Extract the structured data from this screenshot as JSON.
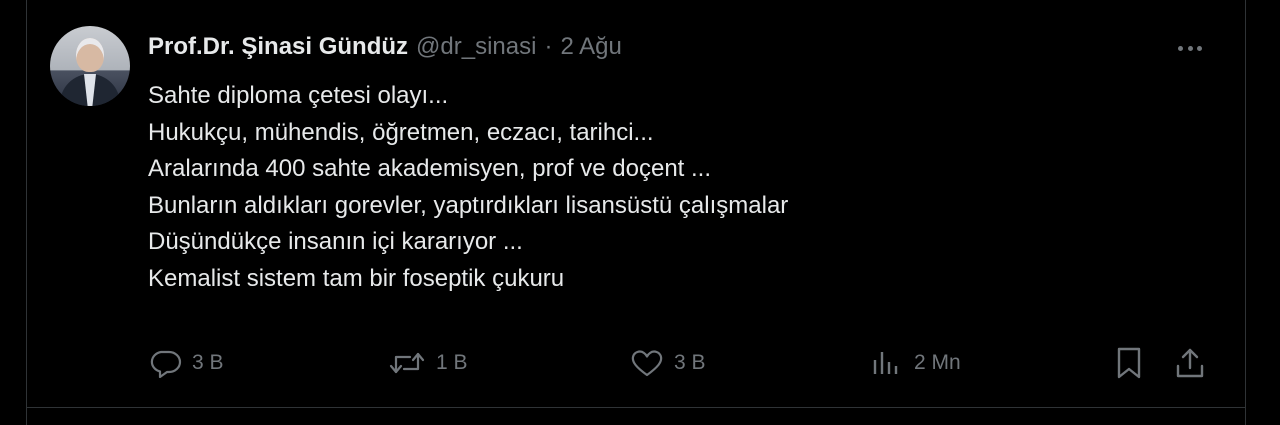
{
  "tweet": {
    "author_name": "Prof.Dr. Şinasi Gündüz",
    "handle": "@dr_sinasi",
    "separator": "·",
    "date": "2 Ağu",
    "lines": [
      "Sahte diploma çetesi olayı...",
      "Hukukçu, mühendis, öğretmen, eczacı, tarihci...",
      "Aralarında 400 sahte akademisyen, prof ve doçent ...",
      "Bunların aldıkları gorevler, yaptırdıkları lisansüstü çalışmalar",
      "Düşündükçe insanın içi kararıyor ...",
      "Kemalist sistem tam bir foseptik çukuru"
    ]
  },
  "actions": {
    "reply_count": "3 B",
    "retweet_count": "1 B",
    "like_count": "3 B",
    "views_count": "2 Mn"
  },
  "icons": {
    "reply": "reply-icon",
    "retweet": "retweet-icon",
    "like": "heart-icon",
    "views": "views-icon",
    "bookmark": "bookmark-icon",
    "share": "share-icon",
    "more": "more-icon"
  },
  "colors": {
    "background": "#000000",
    "text": "#e7e9ea",
    "muted": "#71767b",
    "border": "#2f3336"
  }
}
